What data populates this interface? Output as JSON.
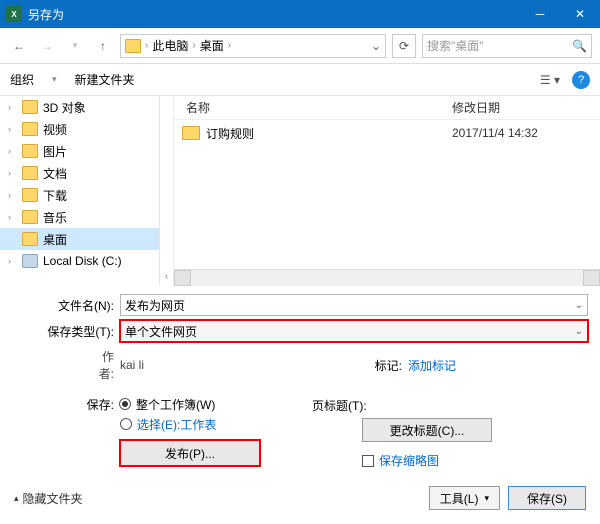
{
  "window": {
    "title": "另存为"
  },
  "nav": {
    "breadcrumb": [
      "此电脑",
      "桌面"
    ],
    "search_placeholder": "搜索\"桌面\""
  },
  "toolbar": {
    "organize": "组织",
    "new_folder": "新建文件夹"
  },
  "tree": {
    "items": [
      {
        "label": "3D 对象",
        "icon": "folder"
      },
      {
        "label": "视频",
        "icon": "folder"
      },
      {
        "label": "图片",
        "icon": "folder"
      },
      {
        "label": "文档",
        "icon": "folder"
      },
      {
        "label": "下载",
        "icon": "folder"
      },
      {
        "label": "音乐",
        "icon": "folder"
      },
      {
        "label": "桌面",
        "icon": "folder",
        "selected": true
      },
      {
        "label": "Local Disk (C:)",
        "icon": "disk"
      }
    ]
  },
  "columns": {
    "name": "名称",
    "date": "修改日期"
  },
  "files": [
    {
      "name": "订购规则",
      "date": "2017/11/4 14:32"
    }
  ],
  "form": {
    "filename_label": "文件名(N):",
    "filename_value": "发布为网页",
    "filetype_label": "保存类型(T):",
    "filetype_value": "单个文件网页",
    "author_label": "作者:",
    "author_value": "kai li",
    "tags_label": "标记:",
    "tags_value": "添加标记",
    "save_label": "保存:",
    "radio_whole": "整个工作簿(W)",
    "radio_sheet": "选择(E):工作表",
    "publish_btn": "发布(P)...",
    "page_title_label": "页标题(T):",
    "change_title_btn": "更改标题(C)...",
    "save_thumb": "保存缩略图"
  },
  "footer": {
    "hide": "隐藏文件夹",
    "tools": "工具(L)",
    "save": "保存(S)"
  }
}
